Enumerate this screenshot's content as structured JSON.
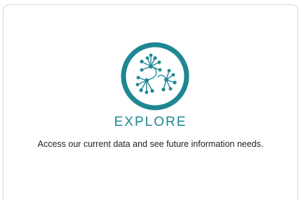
{
  "card": {
    "title": "EXPLORE",
    "description": "Access our current data and see future information needs.",
    "icon": "network-nodes-icon",
    "accent_color": "#1f8793",
    "text_color": "#222222",
    "border_color": "#d6d6d6"
  }
}
